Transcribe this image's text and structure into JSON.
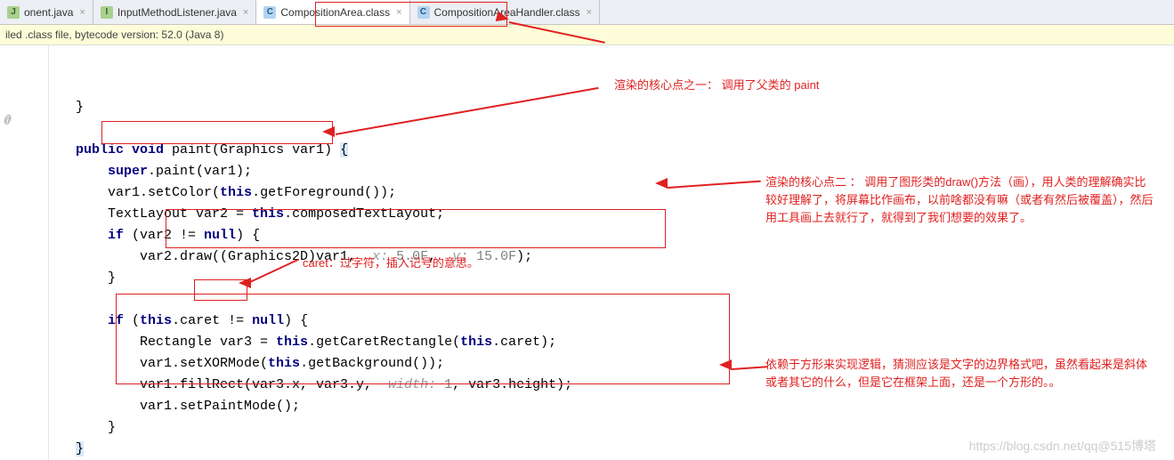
{
  "tabs": [
    {
      "icon": "J",
      "iconClass": "java-icon",
      "label": "onent.java"
    },
    {
      "icon": "I",
      "iconClass": "java-icon",
      "label": "InputMethodListener.java"
    },
    {
      "icon": "C",
      "iconClass": "class-icon",
      "label": "CompositionArea.class",
      "active": true
    },
    {
      "icon": "C",
      "iconClass": "class-icon",
      "label": "CompositionAreaHandler.class"
    }
  ],
  "infoBar": "iled .class file, bytecode version: 52.0 (Java 8)",
  "gutterMark": "@",
  "code": {
    "l0": "}",
    "sig_kw1": "public",
    "sig_kw2": "void",
    "sig_name": " paint(Graphics var1) ",
    "super_kw": "super",
    "super_call": ".paint(var1);",
    "setColor1": "var1.setColor(",
    "this1": "this",
    "setColor2": ".getForeground());",
    "tl1": "TextLayout var2 = ",
    "this2": "this",
    "tl2": ".composedTextLayout;",
    "if1": "if",
    "if1c": " (var2 != ",
    "null1": "null",
    "if1e": ") {",
    "draw1": "var2.draw((Graphics2D)var1, ",
    "hintx": " x: ",
    "vx": "5.0F",
    "comma": ",  ",
    "hinty": "y: ",
    "vy": "15.0F",
    "drawEnd": ");",
    "rb1": "}",
    "if2": "if",
    "if2a": " (",
    "this3": "this",
    "if2b": ".caret != ",
    "null2": "null",
    "if2c": ") {",
    "r1": "Rectangle var3 = ",
    "this4": "this",
    "r2": ".getCaretRectangle(",
    "this5": "this",
    "r3": ".caret);",
    "xor1": "var1.setXORMode(",
    "this6": "this",
    "xor2": ".getBackground());",
    "fill1": "var1.fillRect(var3.x, var3.y,  ",
    "hintw": "width: ",
    "vw": "1",
    "fill2": ", var3.height);",
    "pm": "var1.setPaintMode();",
    "rb2": "}",
    "rb3": "}"
  },
  "annotations": {
    "caretLabel": "caret：过字符，插入记号的意思。",
    "top": "渲染的核心点之一：    调用了父类的 paint",
    "mid": "渲染的核心点二 ：   调用了图形类的draw()方法（画），用人类的理解确实比较好理解了，将屏幕比作画布，以前啥都没有嘛（或者有然后被覆盖），然后用工具画上去就行了，就得到了我们想要的效果了。",
    "bot": "依赖于方形来实现逻辑，猜测应该是文字的边界格式吧，虽然看起来是斜体或者其它的什么，但是它在框架上面，还是一个方形的。。"
  },
  "watermark": "https://blog.csdn.net/qq@515博塔"
}
